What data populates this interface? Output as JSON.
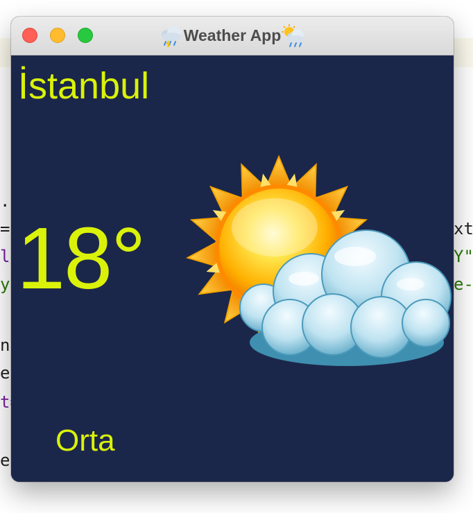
{
  "window": {
    "title": "Weather App",
    "title_icon_left": "rain-cloud-icon",
    "title_icon_right": "sun-behind-rain-cloud-icon"
  },
  "weather": {
    "city": "İstanbul",
    "temperature": "18°",
    "condition": "Orta",
    "icon": "sun-behind-cloud-icon"
  },
  "colors": {
    "background": "#1b274a",
    "accent_text": "#daf20a"
  },
  "background_code": {
    "left_fragments": [
      ".",
      "=\"",
      "la",
      "y\"",
      "n)",
      "er",
      "t=",
      "ea"
    ],
    "right_fragments": [
      "xt",
      "Y\"",
      "e-"
    ]
  }
}
